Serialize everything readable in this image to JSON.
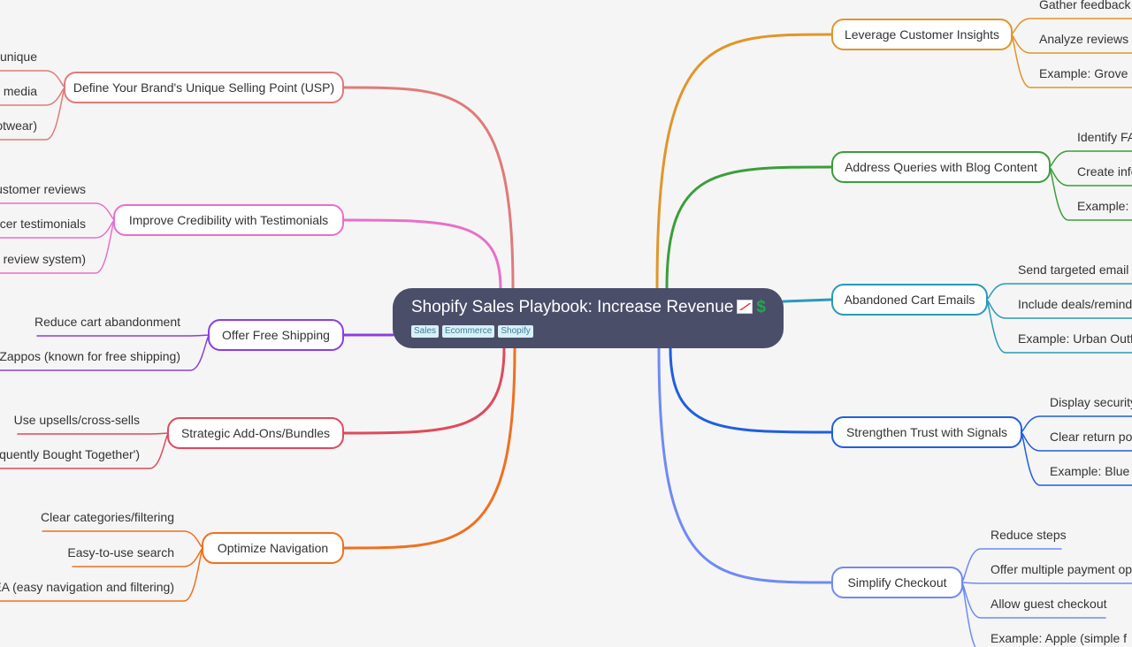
{
  "root": {
    "title": "Shopify Sales Playbook: Increase Revenue",
    "emojis": [
      "chart-increasing-icon",
      "dollar-sign-icon"
    ],
    "tags": [
      "Sales",
      "Ecommerce",
      "Shopify"
    ],
    "color": "#4a4e69"
  },
  "branches": [
    {
      "side": "left",
      "label": "Define Your Brand's Unique Selling Point (USP)",
      "color": "#e07a7a",
      "children": [
        "unique",
        "media",
        "otwear)"
      ]
    },
    {
      "side": "left",
      "label": "Improve Credibility with Testimonials",
      "color": "#e870c8",
      "children": [
        "ustomer reviews",
        "cer testimonials",
        "e review system)"
      ]
    },
    {
      "side": "left",
      "label": "Offer Free Shipping",
      "color": "#8a3fe0",
      "children": [
        "Reduce cart abandonment",
        ": Zappos (known for free shipping)"
      ]
    },
    {
      "side": "left",
      "label": "Strategic Add-Ons/Bundles",
      "color": "#e04a5a",
      "children": [
        "Use upsells/cross-sells",
        "quently Bought Together')"
      ]
    },
    {
      "side": "left",
      "label": "Optimize Navigation",
      "color": "#f07020",
      "children": [
        "Clear categories/filtering",
        "Easy-to-use search",
        "EA (easy navigation and filtering)"
      ]
    },
    {
      "side": "right",
      "label": "Leverage Customer Insights",
      "color": "#e0962a",
      "children": [
        "Gather feedback (",
        "Analyze reviews re",
        "Example: Grove C"
      ]
    },
    {
      "side": "right",
      "label": "Address Queries with Blog Content",
      "color": "#3a9e3a",
      "children": [
        "Identify FA",
        "Create info",
        "Example: C"
      ]
    },
    {
      "side": "right",
      "label": "Abandoned Cart Emails",
      "color": "#2a9ab8",
      "children": [
        "Send targeted email re",
        "Include deals/reminde",
        "Example: Urban Outfit"
      ]
    },
    {
      "side": "right",
      "label": "Strengthen Trust with Signals",
      "color": "#1f5fe0",
      "children": [
        "Display security",
        "Clear return pol",
        "Example: Blue N"
      ]
    },
    {
      "side": "right",
      "label": "Simplify Checkout",
      "color": "#6f8af5",
      "children": [
        "Reduce steps",
        "Offer multiple payment opt",
        "Allow guest checkout",
        "Example: Apple (simple f"
      ]
    }
  ]
}
